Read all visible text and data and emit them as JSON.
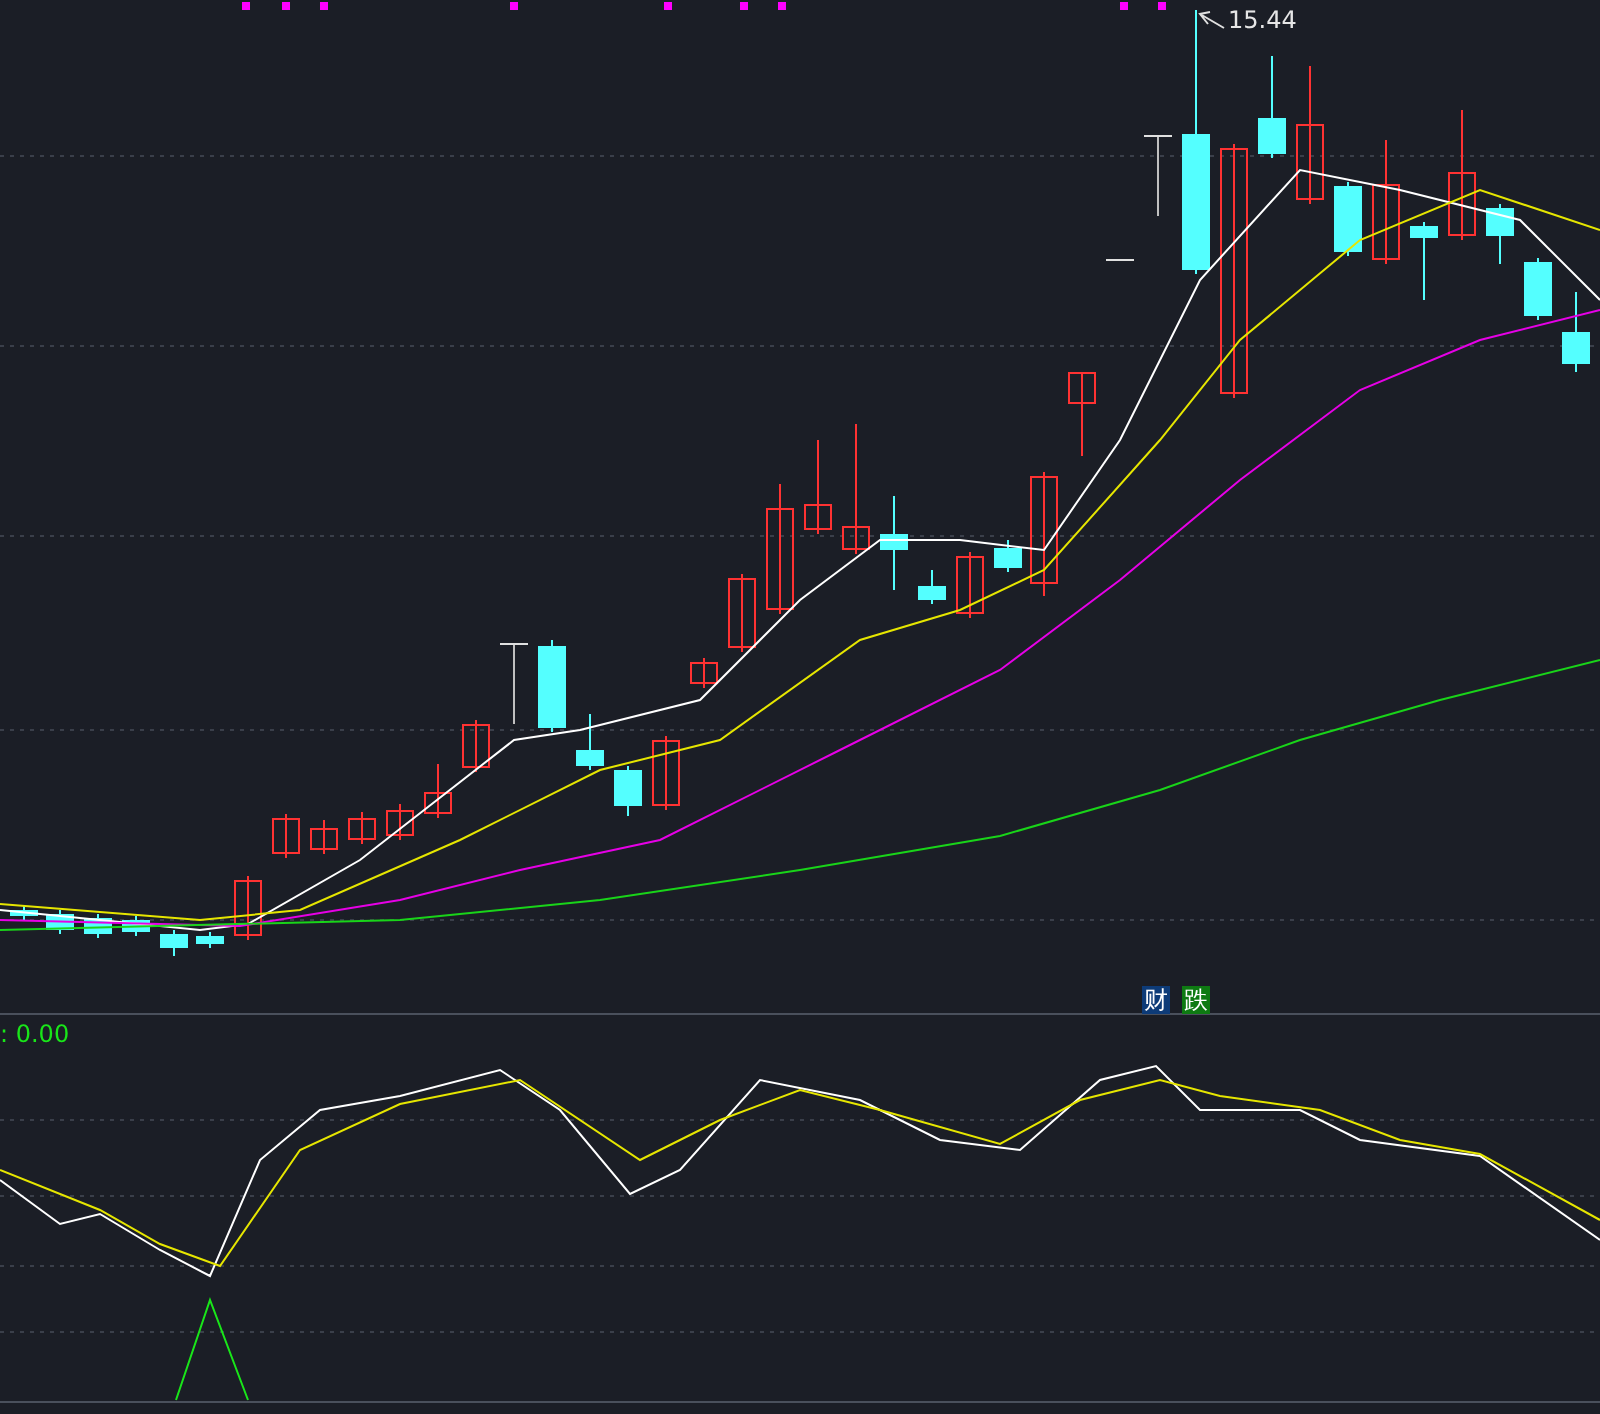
{
  "price_panel": {
    "high_label": "15.44",
    "badges": [
      {
        "text": "财",
        "color": "#0d3b78"
      },
      {
        "text": "跌",
        "color": "#0e7a12"
      }
    ]
  },
  "indicator_panel": {
    "readout": ": 0.00"
  }
}
